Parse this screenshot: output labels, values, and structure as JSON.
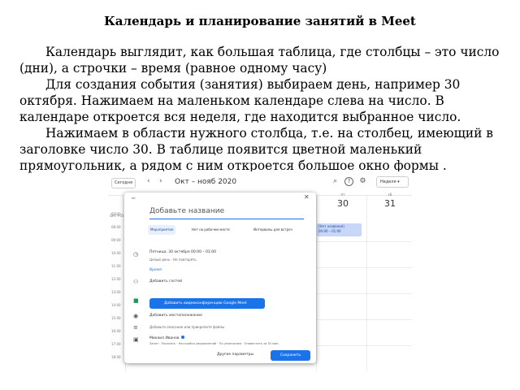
{
  "title": "Календарь и планирование занятий в Meet",
  "paragraphs": [
    "Календарь выглядит, как большая таблица, где столбцы – это число (дни), а строчки – время (равное одному часу)",
    "Для создания события (занятия) выбираем день, например 30 октября. Нажимаем на маленьком календаре слева на число. В календаре откроется вся неделя, где находится выбранное число.",
    "Нажимаем в области нужного столбца, т.е. на столбец, имеющий в заголовке число 30. В таблице появится цветной маленький прямоугольник, а рядом с ним откроется большое окно формы ."
  ],
  "screenshot": {
    "calendar": {
      "today_button": "Сегодня",
      "prev": "‹",
      "next": "›",
      "range": "Окт – нояб 2020",
      "week_button": "Неделя ▾",
      "gmt": "GMT+03",
      "days": [
        {
          "name": "чт",
          "date": "29"
        },
        {
          "name": "пт",
          "date": "30"
        },
        {
          "name": "сб",
          "date": "31"
        }
      ],
      "times": [
        "07:00",
        "08:00",
        "09:00",
        "10:00",
        "11:00",
        "12:00",
        "13:00",
        "14:00",
        "15:00",
        "16:00",
        "17:00",
        "18:00"
      ],
      "event_line1": "(Нет названия)",
      "event_line2": "00:00 – 01:00"
    },
    "dialog": {
      "handle": "═",
      "close": "✕",
      "title_placeholder": "Добавьте название",
      "tabs": [
        "Мероприятие",
        "Нет на рабочем месте",
        "Интервалы для встреч"
      ],
      "datetime": "Пятница, 30 октября   00:00  –  01:00",
      "repeat": "Целый день · Не повторять",
      "time_link": "Время",
      "guests": "Добавить гостей",
      "meet_button": "Добавить видеоконференцию Google Meet",
      "location": "Добавить местоположение",
      "description": "Добавьте описание или прикрепите файлы",
      "owner": "Михаил Иванов",
      "owner_status": "Занят · Показать · Настройки уведомлений · По умолчанию · Оповестить за 30 мин.",
      "more_options": "Другие параметры",
      "save": "Сохранить"
    }
  }
}
